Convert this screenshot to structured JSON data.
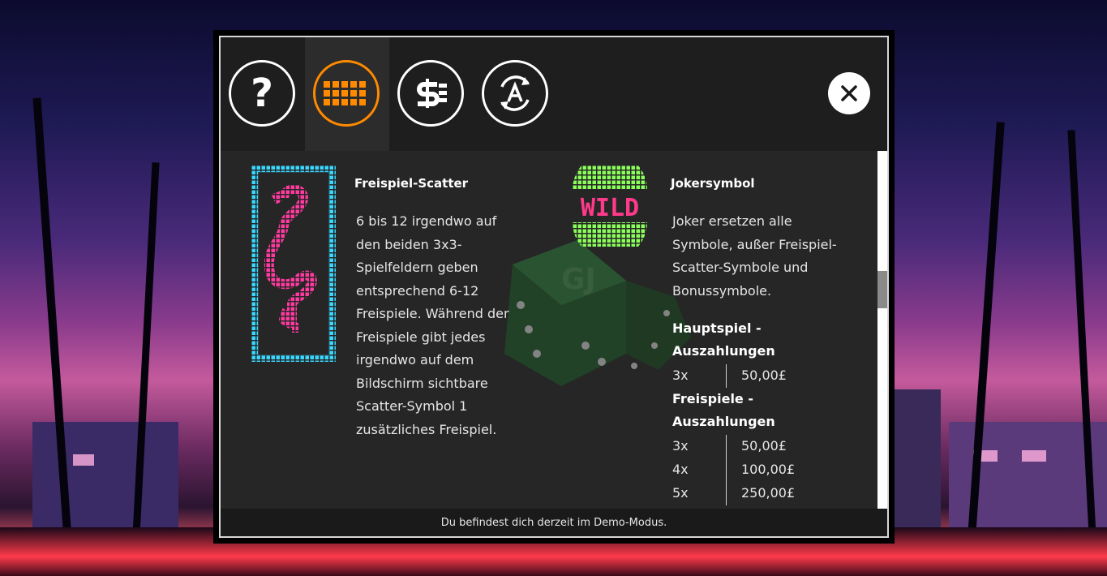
{
  "tabs": [
    {
      "name": "help",
      "icon": "question-icon",
      "active": false
    },
    {
      "name": "paytable",
      "icon": "grid-icon",
      "active": true
    },
    {
      "name": "bet",
      "icon": "dollar-icon",
      "active": false
    },
    {
      "name": "autoplay",
      "icon": "autoplay-icon",
      "active": false
    }
  ],
  "help_glyph": "?",
  "colors": {
    "accent": "#ff8a00",
    "scatter_cyan": "#3ad8ff",
    "scatter_pink": "#ff3aa0",
    "wild_green": "#8aff5a",
    "wild_pink": "#ff3a8a"
  },
  "scatter": {
    "title": "Freispiel-Scatter",
    "lines": [
      "6 bis 12 irgendwo auf",
      "den beiden 3x3-",
      "Spielfeldern geben",
      "entsprechend 6-12",
      "Freispiele. Während der",
      "Freispiele gibt jedes",
      "irgendwo auf dem",
      "Bildschirm sichtbare",
      "Scatter-Symbol 1",
      "zusätzliches Freispiel."
    ]
  },
  "wild": {
    "title": "Jokersymbol",
    "icon_text": "WILD",
    "lines": [
      "Joker ersetzen alle",
      "Symbole, außer Freispiel-",
      "Scatter-Symbole und",
      "Bonussymbole."
    ],
    "main_heading": [
      "Hauptspiel -",
      "Auszahlungen"
    ],
    "main_payouts": [
      {
        "count": "3x",
        "amount": "50,00£"
      }
    ],
    "free_heading": [
      "Freispiele -",
      "Auszahlungen"
    ],
    "free_payouts": [
      {
        "count": "3x",
        "amount": "50,00£"
      },
      {
        "count": "4x",
        "amount": "100,00£"
      },
      {
        "count": "5x",
        "amount": "250,00£"
      }
    ]
  },
  "footer": "Du befindest dich derzeit im Demo-Modus."
}
